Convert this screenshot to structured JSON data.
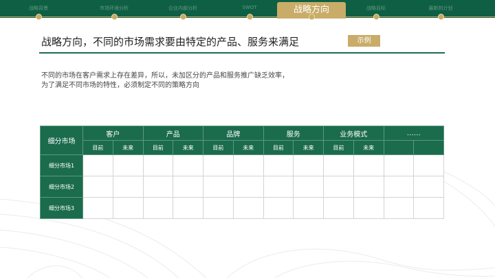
{
  "nav": {
    "items": [
      "战略背景",
      "市场环境分析",
      "企业内部分析",
      "SWOT",
      "战略方向",
      "战略目标",
      "最新的计划"
    ],
    "active_index": 4
  },
  "title": "战略方向，不同的市场需求要由特定的产品、服务来满足",
  "badge": "示例",
  "description": [
    "不同的市场在客户需求上存在差异，所以，未加区分的产品和服务推广缺乏效率，",
    "为了满足不同市场的特性，必须制定不同的策略方向"
  ],
  "table": {
    "corner": "细分市场",
    "groups": [
      "客户",
      "产品",
      "品牌",
      "服务",
      "业务模式",
      "……"
    ],
    "sub": [
      "目前",
      "未来"
    ],
    "rows": [
      "细分市场1",
      "细分市场2",
      "细分市场3"
    ]
  },
  "colors": {
    "primary_green": "#1b6b4d",
    "gold": "#c9ac68"
  }
}
